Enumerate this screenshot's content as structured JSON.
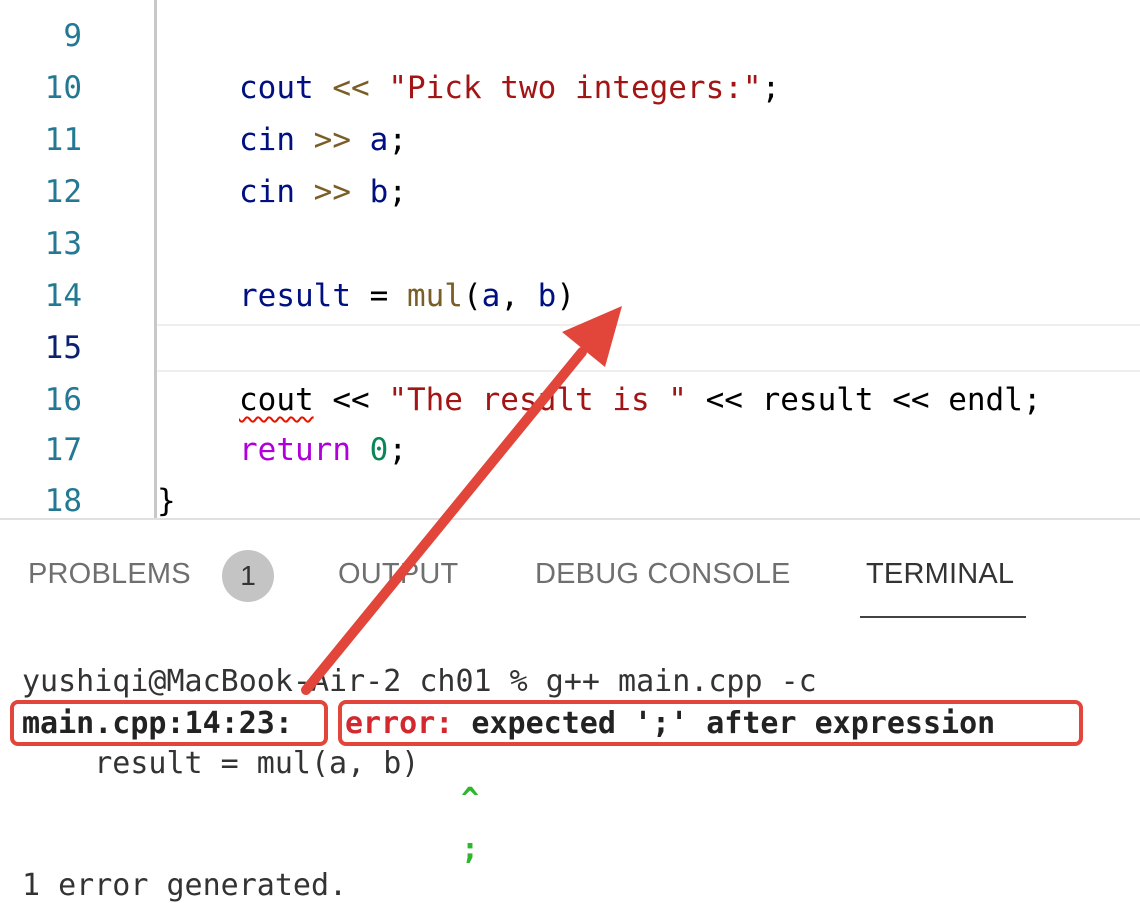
{
  "editor": {
    "lines": [
      {
        "num": "9"
      },
      {
        "num": "10",
        "p1": "cout",
        "p2": " << ",
        "p3": "\"Pick two integers:\"",
        "p4": ";"
      },
      {
        "num": "11",
        "p1": "cin",
        "p2": " >> ",
        "p3": "a",
        "p4": ";"
      },
      {
        "num": "12",
        "p1": "cin",
        "p2": " >> ",
        "p3": "b",
        "p4": ";"
      },
      {
        "num": "13"
      },
      {
        "num": "14",
        "p1": "result",
        "p2": " = ",
        "p3": "mul",
        "p4": "(",
        "p5": "a",
        "p6": ", ",
        "p7": "b",
        "p8": ")"
      },
      {
        "num": "15"
      },
      {
        "num": "16",
        "p1": "cout",
        "p2": " << ",
        "p3": "\"The result is \"",
        "p4": " << ",
        "p5": "result",
        "p6": " << ",
        "p7": "endl",
        "p8": ";"
      },
      {
        "num": "17",
        "p1": "return",
        "p2": " ",
        "p3": "0",
        "p4": ";"
      },
      {
        "num": "18",
        "p1": "}"
      }
    ]
  },
  "panel": {
    "tabs": [
      "PROBLEMS",
      "OUTPUT",
      "DEBUG CONSOLE",
      "TERMINAL"
    ],
    "problems_count": "1",
    "active_tab": "TERMINAL"
  },
  "terminal": {
    "prompt": "yushiqi@MacBook-Air-2 ch01 % g++ main.cpp -c",
    "location": "main.cpp:14:23:",
    "error_label": "error:",
    "error_message": " expected ';' after expression",
    "source_line": "    result = mul(a, b)",
    "caret": "^",
    "fixit": ";",
    "summary": "1 error generated."
  },
  "annotation": {
    "color": "#e2453a"
  }
}
